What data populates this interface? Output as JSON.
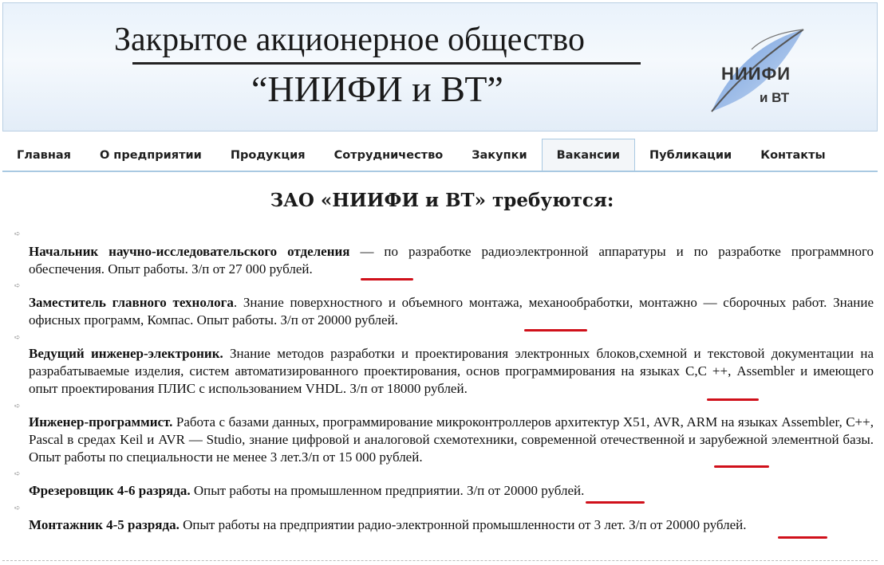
{
  "header": {
    "title_line1": "Закрытое акционерное общество",
    "title_line2": "“НИИФИ и ВТ”",
    "logo_text_main": "НИИФИ",
    "logo_text_sub": "и ВТ",
    "logo_icon": "leaf-logo-icon"
  },
  "nav": {
    "items": [
      {
        "label": "Главная"
      },
      {
        "label": "О предприятии"
      },
      {
        "label": "Продукция"
      },
      {
        "label": "Сотрудничество"
      },
      {
        "label": "Закупки"
      },
      {
        "label": "Вакансии",
        "active": true
      },
      {
        "label": "Публикации"
      },
      {
        "label": "Контакты"
      }
    ]
  },
  "main": {
    "heading": "ЗАО «НИИФИ и ВТ» требуются:",
    "bullet_icon": "arrow-bullet-icon",
    "vacancies": [
      {
        "title": "Начальник научно-исследовательского отделения",
        "description": " — по разработке радиоэлектронной аппаратуры и по разработке программного обеспечения. Опыт работы. З/п от 27 000 рублей."
      },
      {
        "title": "Заместитель главного технолога",
        "description": ". Знание поверхностного и объемного монтажа, механообработки, монтажно — сборочных работ. Знание офисных программ, Компас. Опыт работы. З/п от 20000 рублей."
      },
      {
        "title": "Ведущий инженер-электроник.",
        "description": " Знание методов разработки и проектирования электронных блоков,схемной и текстовой документации на разрабатываемые изделия, систем автоматизированного проектирования, основ программирования на языках С,С ++, Assembler  и имеющего опыт проектирования ПЛИС с использованием VHDL. З/п от 18000 рублей."
      },
      {
        "title": "Инженер-программист.",
        "description": " Работа с базами данных, программирование микроконтроллеров архитектур Х51, AVR, ARM на языках Assembler, C++, Pascal в средах Keil и AVR — Studio, знание цифровой и аналоговой схемотехники, современной отечественной и зарубежной элементной базы. Опыт работы по специальности не менее 3 лет.З/п от 15 000 рублей."
      },
      {
        "title": "Фрезеровщик 4-6 разряда.",
        "description": " Опыт работы на промышленном предприятии. З/п от 20000 рублей."
      },
      {
        "title": "Монтажник 4-5 разряда.",
        "description": " Опыт работы на предприятии радио-электронной промышленности от 3 лет. З/п от 20000 рублей."
      }
    ],
    "highlight_color": "#d0101a"
  }
}
